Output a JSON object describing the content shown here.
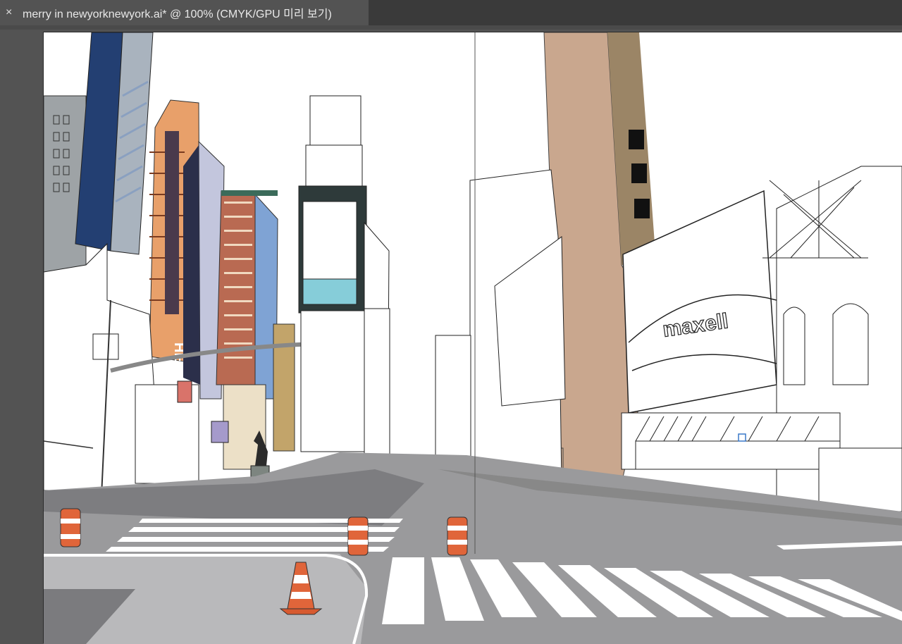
{
  "window": {
    "tab_close_glyph": "×",
    "document_tab_title": "merry in newyorknewyork.ai* @ 100% (CMYK/GPU 미리 보기)"
  },
  "artwork": {
    "billboard_brand": "maxell",
    "sign_text": "HEYS",
    "colors": {
      "sky": "#ffffff",
      "road": "#9a9a9c",
      "road_dark": "#7d7d80",
      "sidewalk": "#b9b9bb",
      "crosswalk": "#ffffff",
      "blue_tower": "#233f72",
      "tan_tower": "#c9a78e",
      "orange_building": "#e8a06a",
      "brick": "#b96a52",
      "cone_orange": "#e0653a"
    }
  }
}
